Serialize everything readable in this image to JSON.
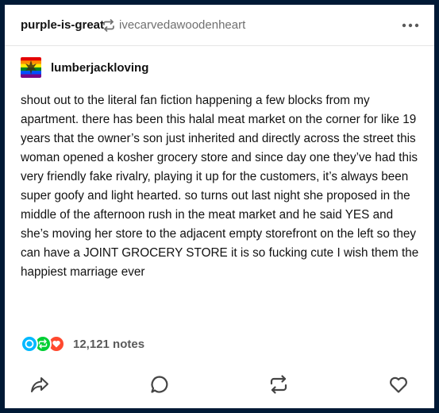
{
  "header": {
    "reblogger": "purple-is-great",
    "source_user": "ivecarvedawoodenheart"
  },
  "post": {
    "author": "lumberjackloving",
    "body": "shout out to the literal fan fiction happening a few blocks from my apartment. there has been this halal meat market on the corner for like 19 years that the owner’s son just inherited and directly across the street this woman opened a kosher grocery store and since day one they’ve had this very friendly fake rivalry, playing it up for the customers, it’s always been super goofy and light hearted. so turns out last night she proposed in the middle of the afternoon rush in the meat market and he said YES and she’s moving her store to the adjacent empty storefront on the left so they can have a JOINT GROCERY STORE it is so fucking cute I wish them the happiest marriage ever"
  },
  "notes": {
    "count": "12,121 notes"
  },
  "icons": {
    "header": [
      "reblog-icon",
      "more-icon"
    ],
    "notes": [
      "reply-note-icon",
      "reblog-note-icon",
      "like-note-icon"
    ],
    "actions": [
      "share-icon",
      "reply-icon",
      "reblog-icon",
      "like-icon"
    ]
  },
  "colors": {
    "page_background": "#001935",
    "card_background": "#ffffff",
    "text": "#121212",
    "muted_text": "#707070",
    "note_reply": "#00b8ff",
    "note_reblog": "#00cf35",
    "note_like": "#ff492f"
  }
}
